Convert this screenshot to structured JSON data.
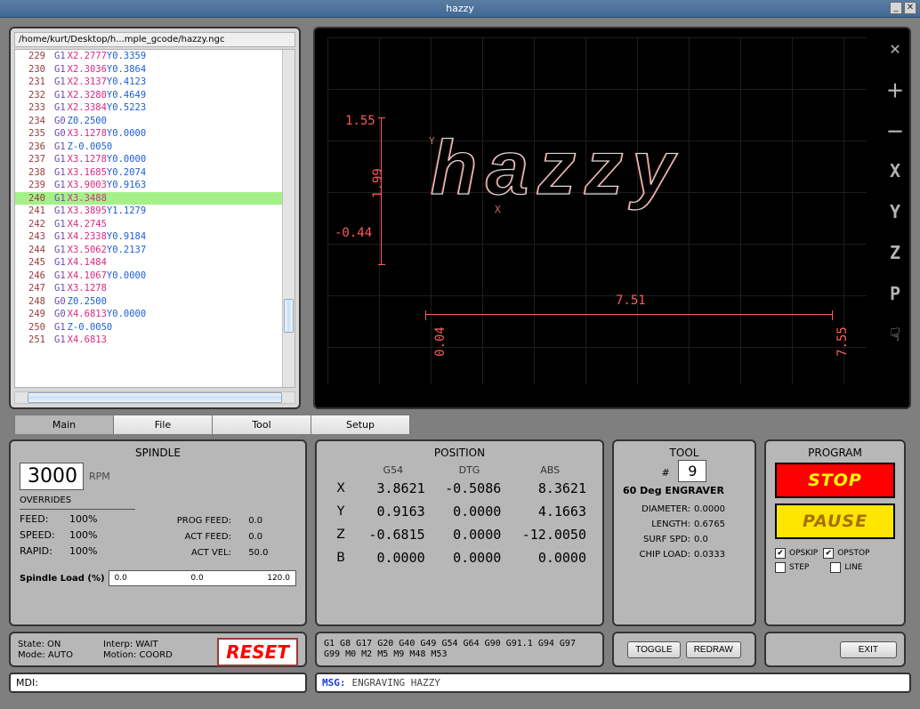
{
  "window": {
    "title": "hazzy"
  },
  "gcode": {
    "filepath": "/home/kurt/Desktop/h...mple_gcode/hazzy.ngc",
    "selected_line": 240,
    "lines": [
      {
        "n": 229,
        "cmd": "G1",
        "x": "X2.2777",
        "y": "Y0.3359"
      },
      {
        "n": 230,
        "cmd": "G1",
        "x": "X2.3036",
        "y": "Y0.3864"
      },
      {
        "n": 231,
        "cmd": "G1",
        "x": "X2.3137",
        "y": "Y0.4123"
      },
      {
        "n": 232,
        "cmd": "G1",
        "x": "X2.3280",
        "y": "Y0.4649"
      },
      {
        "n": 233,
        "cmd": "G1",
        "x": "X2.3384",
        "y": "Y0.5223"
      },
      {
        "n": 234,
        "cmd": "G0",
        "z": "Z0.2500"
      },
      {
        "n": 235,
        "cmd": "G0",
        "x": "X3.1278",
        "y": "Y0.0000"
      },
      {
        "n": 236,
        "cmd": "G1",
        "z": "Z-0.0050"
      },
      {
        "n": 237,
        "cmd": "G1",
        "x": "X3.1278",
        "y": "Y0.0000"
      },
      {
        "n": 238,
        "cmd": "G1",
        "x": "X3.1685",
        "y": "Y0.2074"
      },
      {
        "n": 239,
        "cmd": "G1",
        "x": "X3.9003",
        "y": "Y0.9163"
      },
      {
        "n": 240,
        "cmd": "G1",
        "x": "X3.3488"
      },
      {
        "n": 241,
        "cmd": "G1",
        "x": "X3.3895",
        "y": "Y1.1279"
      },
      {
        "n": 242,
        "cmd": "G1",
        "x": "X4.2745"
      },
      {
        "n": 243,
        "cmd": "G1",
        "x": "X4.2338",
        "y": "Y0.9184"
      },
      {
        "n": 244,
        "cmd": "G1",
        "x": "X3.5062",
        "y": "Y0.2137"
      },
      {
        "n": 245,
        "cmd": "G1",
        "x": "X4.1484"
      },
      {
        "n": 246,
        "cmd": "G1",
        "x": "X4.1067",
        "y": "Y0.0000"
      },
      {
        "n": 247,
        "cmd": "G1",
        "x": "X3.1278"
      },
      {
        "n": 248,
        "cmd": "G0",
        "z": "Z0.2500"
      },
      {
        "n": 249,
        "cmd": "G0",
        "x": "X4.6813",
        "y": "Y0.0000"
      },
      {
        "n": 250,
        "cmd": "G1",
        "z": "Z-0.0050"
      },
      {
        "n": 251,
        "cmd": "G1",
        "x": "X4.6813"
      }
    ]
  },
  "viz": {
    "y_top": "1.55",
    "y_span": "1.99",
    "y_bot": "-0.44",
    "x_span": "7.51",
    "x_left": "0.04",
    "x_right": "7.55",
    "axis_x_label": "X",
    "axis_y_label": "Y",
    "word": "hazzy",
    "controls": [
      "✕",
      "＋",
      "－",
      "X",
      "Y",
      "Z",
      "P",
      "☟"
    ],
    "control_names": [
      "tools-icon",
      "zoom-in-icon",
      "zoom-out-icon",
      "view-x-button",
      "view-y-button",
      "view-z-button",
      "view-p-button",
      "pan-icon"
    ]
  },
  "tabs": [
    "Main",
    "File",
    "Tool",
    "Setup"
  ],
  "spindle": {
    "title": "SPINDLE",
    "rpm": "3000",
    "rpm_unit": "RPM",
    "overrides_label": "OVERRIDES",
    "feed_lbl": "FEED:",
    "feed_val": "100%",
    "speed_lbl": "SPEED:",
    "speed_val": "100%",
    "rapid_lbl": "RAPID:",
    "rapid_val": "100%",
    "progfeed_lbl": "PROG FEED:",
    "progfeed_val": "0.0",
    "actfeed_lbl": "ACT FEED:",
    "actfeed_val": "0.0",
    "actvel_lbl": "ACT VEL:",
    "actvel_val": "50.0",
    "load_lbl": "Spindle Load (%)",
    "load_min": "0.0",
    "load_cur": "0.0",
    "load_max": "120.0"
  },
  "position": {
    "title": "POSITION",
    "headers": [
      "G54",
      "DTG",
      "ABS"
    ],
    "rows": [
      {
        "ax": "X",
        "g54": "3.8621",
        "dtg": "-0.5086",
        "abs": "8.3621"
      },
      {
        "ax": "Y",
        "g54": "0.9163",
        "dtg": "0.0000",
        "abs": "4.1663"
      },
      {
        "ax": "Z",
        "g54": "-0.6815",
        "dtg": "0.0000",
        "abs": "-12.0050"
      },
      {
        "ax": "B",
        "g54": "0.0000",
        "dtg": "0.0000",
        "abs": "0.0000"
      }
    ]
  },
  "tool": {
    "title": "TOOL",
    "hash": "#",
    "num": "9",
    "desc": "60 Deg ENGRAVER",
    "diameter_lbl": "DIAMETER:",
    "diameter": "0.0000",
    "length_lbl": "LENGTH:",
    "length": "0.6765",
    "surfspd_lbl": "SURF SPD:",
    "surfspd": "0.0",
    "chipload_lbl": "CHIP LOAD:",
    "chipload": "0.0333"
  },
  "program": {
    "title": "PROGRAM",
    "stop": "STOP",
    "pause": "PAUSE",
    "opskip": "OPSKIP",
    "opstop": "OPSTOP",
    "step": "STEP",
    "line": "LINE",
    "opskip_checked": true,
    "opstop_checked": true,
    "step_checked": false,
    "line_checked": false
  },
  "state": {
    "state_lbl": "State:",
    "state": "ON",
    "interp_lbl": "Interp:",
    "interp": "WAIT",
    "mode_lbl": "Mode:",
    "mode": "AUTO",
    "motion_lbl": "Motion:",
    "motion": "COORD",
    "reset": "RESET"
  },
  "activeg": "G1 G8 G17 G20 G40 G49 G54 G64 G90 G91.1 G94 G97 G99 M0 M2 M5 M9 M48 M53",
  "toggle": "TOGGLE",
  "redraw": "REDRAW",
  "exit": "EXIT",
  "mdi_lbl": "MDI:",
  "msg_lbl": "MSG:",
  "msg_txt": "ENGRAVING HAZZY"
}
